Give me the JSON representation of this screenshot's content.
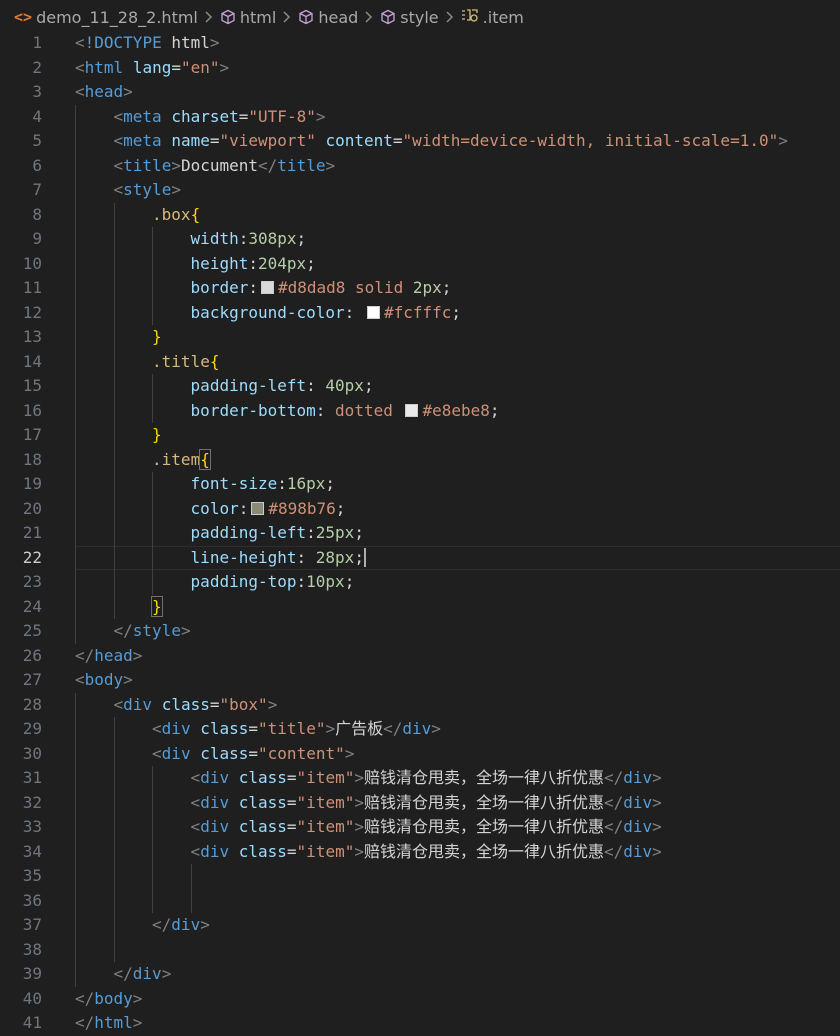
{
  "breadcrumb": {
    "file": "demo_11_28_2.html",
    "items": [
      "html",
      "head",
      "style",
      ".item"
    ]
  },
  "colors": {
    "background": "#1f1f1f",
    "tag": "#569cd6",
    "attribute": "#9cdcfe",
    "string": "#ce9178",
    "selector": "#d7ba7d",
    "number": "#b5cea8",
    "brace": "#ffd700"
  },
  "editor": {
    "current_line": 22,
    "lines": [
      {
        "n": 1,
        "indent": 0,
        "t": [
          [
            "brk",
            "<"
          ],
          [
            "kw",
            "!DOCTYPE"
          ],
          [
            "text",
            " html"
          ],
          [
            "brk",
            ">"
          ]
        ]
      },
      {
        "n": 2,
        "indent": 0,
        "t": [
          [
            "brk",
            "<"
          ],
          [
            "tag",
            "html"
          ],
          [
            "text",
            " "
          ],
          [
            "attr",
            "lang"
          ],
          [
            "eq",
            "="
          ],
          [
            "str",
            "\"en\""
          ],
          [
            "brk",
            ">"
          ]
        ]
      },
      {
        "n": 3,
        "indent": 0,
        "t": [
          [
            "brk",
            "<"
          ],
          [
            "tag",
            "head"
          ],
          [
            "brk",
            ">"
          ]
        ]
      },
      {
        "n": 4,
        "indent": 1,
        "t": [
          [
            "brk",
            "<"
          ],
          [
            "tag",
            "meta"
          ],
          [
            "text",
            " "
          ],
          [
            "attr",
            "charset"
          ],
          [
            "eq",
            "="
          ],
          [
            "str",
            "\"UTF-8\""
          ],
          [
            "brk",
            ">"
          ]
        ]
      },
      {
        "n": 5,
        "indent": 1,
        "t": [
          [
            "brk",
            "<"
          ],
          [
            "tag",
            "meta"
          ],
          [
            "text",
            " "
          ],
          [
            "attr",
            "name"
          ],
          [
            "eq",
            "="
          ],
          [
            "str",
            "\"viewport\""
          ],
          [
            "text",
            " "
          ],
          [
            "attr",
            "content"
          ],
          [
            "eq",
            "="
          ],
          [
            "str",
            "\"width=device-width, initial-scale=1.0\""
          ],
          [
            "brk",
            ">"
          ]
        ]
      },
      {
        "n": 6,
        "indent": 1,
        "t": [
          [
            "brk",
            "<"
          ],
          [
            "tag",
            "title"
          ],
          [
            "brk",
            ">"
          ],
          [
            "text",
            "Document"
          ],
          [
            "brk",
            "</"
          ],
          [
            "tag",
            "title"
          ],
          [
            "brk",
            ">"
          ]
        ]
      },
      {
        "n": 7,
        "indent": 1,
        "t": [
          [
            "brk",
            "<"
          ],
          [
            "tag",
            "style"
          ],
          [
            "brk",
            ">"
          ]
        ]
      },
      {
        "n": 8,
        "indent": 2,
        "t": [
          [
            "sel",
            ".box"
          ],
          [
            "brace",
            "{"
          ]
        ]
      },
      {
        "n": 9,
        "indent": 3,
        "t": [
          [
            "prop",
            "width"
          ],
          [
            "punc",
            ":"
          ],
          [
            "num",
            "308px"
          ],
          [
            "punc",
            ";"
          ]
        ]
      },
      {
        "n": 10,
        "indent": 3,
        "t": [
          [
            "prop",
            "height"
          ],
          [
            "punc",
            ":"
          ],
          [
            "num",
            "204px"
          ],
          [
            "punc",
            ";"
          ]
        ]
      },
      {
        "n": 11,
        "indent": 3,
        "t": [
          [
            "prop",
            "border"
          ],
          [
            "punc",
            ":"
          ],
          [
            "swatch",
            "#d8dad8"
          ],
          [
            "val",
            "#d8dad8 solid "
          ],
          [
            "num",
            "2px"
          ],
          [
            "punc",
            ";"
          ]
        ]
      },
      {
        "n": 12,
        "indent": 3,
        "t": [
          [
            "prop",
            "background-color"
          ],
          [
            "punc",
            ": "
          ],
          [
            "swatch",
            "#fcfffc"
          ],
          [
            "val",
            "#fcfffc"
          ],
          [
            "punc",
            ";"
          ]
        ]
      },
      {
        "n": 13,
        "indent": 2,
        "t": [
          [
            "brace",
            "}"
          ]
        ]
      },
      {
        "n": 14,
        "indent": 2,
        "t": [
          [
            "sel",
            ".title"
          ],
          [
            "brace",
            "{"
          ]
        ]
      },
      {
        "n": 15,
        "indent": 3,
        "t": [
          [
            "prop",
            "padding-left"
          ],
          [
            "punc",
            ": "
          ],
          [
            "num",
            "40px"
          ],
          [
            "punc",
            ";"
          ]
        ]
      },
      {
        "n": 16,
        "indent": 3,
        "t": [
          [
            "prop",
            "border-bottom"
          ],
          [
            "punc",
            ": "
          ],
          [
            "val",
            "dotted "
          ],
          [
            "swatch",
            "#e8ebe8"
          ],
          [
            "val",
            "#e8ebe8"
          ],
          [
            "punc",
            ";"
          ]
        ]
      },
      {
        "n": 17,
        "indent": 2,
        "t": [
          [
            "brace",
            "}"
          ]
        ]
      },
      {
        "n": 18,
        "indent": 2,
        "t": [
          [
            "sel",
            ".item"
          ],
          [
            "bracehl",
            "{"
          ]
        ]
      },
      {
        "n": 19,
        "indent": 3,
        "t": [
          [
            "prop",
            "font-size"
          ],
          [
            "punc",
            ":"
          ],
          [
            "num",
            "16px"
          ],
          [
            "punc",
            ";"
          ]
        ]
      },
      {
        "n": 20,
        "indent": 3,
        "t": [
          [
            "prop",
            "color"
          ],
          [
            "punc",
            ":"
          ],
          [
            "swatch",
            "#898b76"
          ],
          [
            "val",
            "#898b76"
          ],
          [
            "punc",
            ";"
          ]
        ]
      },
      {
        "n": 21,
        "indent": 3,
        "t": [
          [
            "prop",
            "padding-left"
          ],
          [
            "punc",
            ":"
          ],
          [
            "num",
            "25px"
          ],
          [
            "punc",
            ";"
          ]
        ]
      },
      {
        "n": 22,
        "indent": 3,
        "t": [
          [
            "prop",
            "line-height"
          ],
          [
            "punc",
            ": "
          ],
          [
            "num",
            "28px"
          ],
          [
            "punc",
            ";"
          ],
          [
            "cursor",
            ""
          ]
        ]
      },
      {
        "n": 23,
        "indent": 3,
        "t": [
          [
            "prop",
            "padding-top"
          ],
          [
            "punc",
            ":"
          ],
          [
            "num",
            "10px"
          ],
          [
            "punc",
            ";"
          ]
        ]
      },
      {
        "n": 24,
        "indent": 2,
        "t": [
          [
            "bracehl",
            "}"
          ]
        ]
      },
      {
        "n": 25,
        "indent": 1,
        "t": [
          [
            "brk",
            "</"
          ],
          [
            "tag",
            "style"
          ],
          [
            "brk",
            ">"
          ]
        ]
      },
      {
        "n": 26,
        "indent": 0,
        "t": [
          [
            "brk",
            "</"
          ],
          [
            "tag",
            "head"
          ],
          [
            "brk",
            ">"
          ]
        ]
      },
      {
        "n": 27,
        "indent": 0,
        "t": [
          [
            "brk",
            "<"
          ],
          [
            "tag",
            "body"
          ],
          [
            "brk",
            ">"
          ]
        ]
      },
      {
        "n": 28,
        "indent": 1,
        "t": [
          [
            "brk",
            "<"
          ],
          [
            "tag",
            "div"
          ],
          [
            "text",
            " "
          ],
          [
            "attr",
            "class"
          ],
          [
            "eq",
            "="
          ],
          [
            "str",
            "\"box\""
          ],
          [
            "brk",
            ">"
          ]
        ]
      },
      {
        "n": 29,
        "indent": 2,
        "t": [
          [
            "brk",
            "<"
          ],
          [
            "tag",
            "div"
          ],
          [
            "text",
            " "
          ],
          [
            "attr",
            "class"
          ],
          [
            "eq",
            "="
          ],
          [
            "str",
            "\"title\""
          ],
          [
            "brk",
            ">"
          ],
          [
            "text",
            "广告板"
          ],
          [
            "brk",
            "</"
          ],
          [
            "tag",
            "div"
          ],
          [
            "brk",
            ">"
          ]
        ]
      },
      {
        "n": 30,
        "indent": 2,
        "t": [
          [
            "brk",
            "<"
          ],
          [
            "tag",
            "div"
          ],
          [
            "text",
            " "
          ],
          [
            "attr",
            "class"
          ],
          [
            "eq",
            "="
          ],
          [
            "str",
            "\"content\""
          ],
          [
            "brk",
            ">"
          ]
        ]
      },
      {
        "n": 31,
        "indent": 3,
        "t": [
          [
            "brk",
            "<"
          ],
          [
            "tag",
            "div"
          ],
          [
            "text",
            " "
          ],
          [
            "attr",
            "class"
          ],
          [
            "eq",
            "="
          ],
          [
            "str",
            "\"item\""
          ],
          [
            "brk",
            ">"
          ],
          [
            "text",
            "赔钱清仓甩卖，全场一律八折优惠"
          ],
          [
            "brk",
            "</"
          ],
          [
            "tag",
            "div"
          ],
          [
            "brk",
            ">"
          ]
        ]
      },
      {
        "n": 32,
        "indent": 3,
        "t": [
          [
            "brk",
            "<"
          ],
          [
            "tag",
            "div"
          ],
          [
            "text",
            " "
          ],
          [
            "attr",
            "class"
          ],
          [
            "eq",
            "="
          ],
          [
            "str",
            "\"item\""
          ],
          [
            "brk",
            ">"
          ],
          [
            "text",
            "赔钱清仓甩卖，全场一律八折优惠"
          ],
          [
            "brk",
            "</"
          ],
          [
            "tag",
            "div"
          ],
          [
            "brk",
            ">"
          ]
        ]
      },
      {
        "n": 33,
        "indent": 3,
        "t": [
          [
            "brk",
            "<"
          ],
          [
            "tag",
            "div"
          ],
          [
            "text",
            " "
          ],
          [
            "attr",
            "class"
          ],
          [
            "eq",
            "="
          ],
          [
            "str",
            "\"item\""
          ],
          [
            "brk",
            ">"
          ],
          [
            "text",
            "赔钱清仓甩卖，全场一律八折优惠"
          ],
          [
            "brk",
            "</"
          ],
          [
            "tag",
            "div"
          ],
          [
            "brk",
            ">"
          ]
        ]
      },
      {
        "n": 34,
        "indent": 3,
        "t": [
          [
            "brk",
            "<"
          ],
          [
            "tag",
            "div"
          ],
          [
            "text",
            " "
          ],
          [
            "attr",
            "class"
          ],
          [
            "eq",
            "="
          ],
          [
            "str",
            "\"item\""
          ],
          [
            "brk",
            ">"
          ],
          [
            "text",
            "赔钱清仓甩卖，全场一律八折优惠"
          ],
          [
            "brk",
            "</"
          ],
          [
            "tag",
            "div"
          ],
          [
            "brk",
            ">"
          ]
        ]
      },
      {
        "n": 35,
        "indent": 0,
        "t": []
      },
      {
        "n": 36,
        "indent": 0,
        "t": []
      },
      {
        "n": 37,
        "indent": 2,
        "t": [
          [
            "brk",
            "</"
          ],
          [
            "tag",
            "div"
          ],
          [
            "brk",
            ">"
          ]
        ]
      },
      {
        "n": 38,
        "indent": 0,
        "t": []
      },
      {
        "n": 39,
        "indent": 1,
        "t": [
          [
            "brk",
            "</"
          ],
          [
            "tag",
            "div"
          ],
          [
            "brk",
            ">"
          ]
        ]
      },
      {
        "n": 40,
        "indent": 0,
        "t": [
          [
            "brk",
            "</"
          ],
          [
            "tag",
            "body"
          ],
          [
            "brk",
            ">"
          ]
        ]
      },
      {
        "n": 41,
        "indent": 0,
        "t": [
          [
            "brk",
            "</"
          ],
          [
            "tag",
            "html"
          ],
          [
            "brk",
            ">"
          ]
        ]
      }
    ]
  }
}
